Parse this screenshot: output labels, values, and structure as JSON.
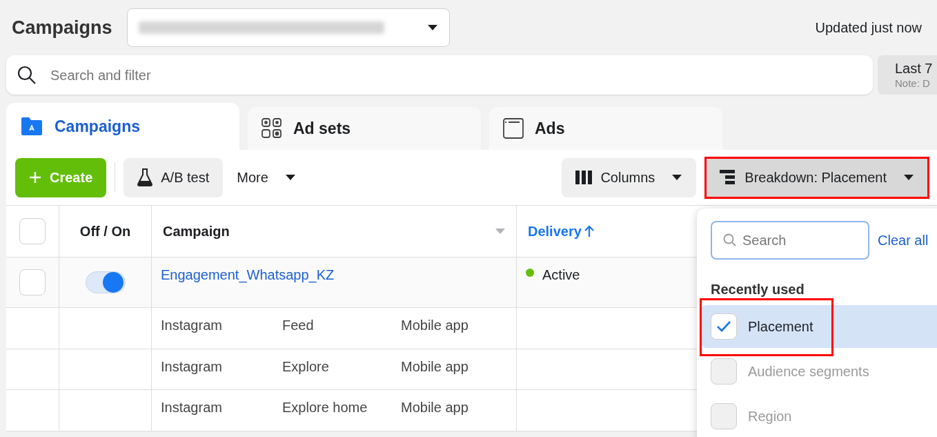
{
  "header": {
    "title": "Campaigns",
    "updated": "Updated just now"
  },
  "search": {
    "placeholder": "Search and filter"
  },
  "date_range": {
    "label": "Last 7",
    "note": "Note: D"
  },
  "tabs": [
    {
      "label": "Campaigns",
      "selected": true
    },
    {
      "label": "Ad sets",
      "selected": false
    },
    {
      "label": "Ads",
      "selected": false
    }
  ],
  "toolbar": [
    {
      "kind": "create",
      "label": "Create"
    },
    {
      "kind": "ab_test",
      "label": "A/B test"
    },
    {
      "kind": "more",
      "label": "More"
    },
    {
      "kind": "columns",
      "label": "Columns"
    },
    {
      "kind": "breakdown",
      "label": "Breakdown: Placement",
      "highlighted": true
    }
  ],
  "table": {
    "select_all_checked": false,
    "columns": [
      {
        "label": "Off / On",
        "sorted": false
      },
      {
        "label": "Campaign",
        "sorted": false
      },
      {
        "label": "Delivery",
        "sorted": true
      }
    ],
    "rows": [
      {
        "checked": false,
        "on": true,
        "name": "Engagement_Whatsapp_KZ",
        "status": "Active",
        "color": "#63be09",
        "breakdown": [
          {
            "cells": [
              "Instagram",
              "Feed",
              "Mobile app"
            ]
          },
          {
            "cells": [
              "Instagram",
              "Explore",
              "Mobile app"
            ]
          },
          {
            "cells": [
              "Instagram",
              "Explore home",
              "Mobile app"
            ]
          }
        ]
      }
    ]
  },
  "breakdown_menu": {
    "search_placeholder": "Search",
    "clear": "Clear all",
    "section": "Recently used",
    "items": [
      {
        "label": "Placement",
        "checked": true,
        "selected": true,
        "disabled": false,
        "highlighted": true
      },
      {
        "label": "Audience segments",
        "checked": false,
        "selected": false,
        "disabled": true,
        "highlighted": false
      },
      {
        "label": "Region",
        "checked": false,
        "selected": false,
        "disabled": true,
        "highlighted": false
      }
    ]
  }
}
